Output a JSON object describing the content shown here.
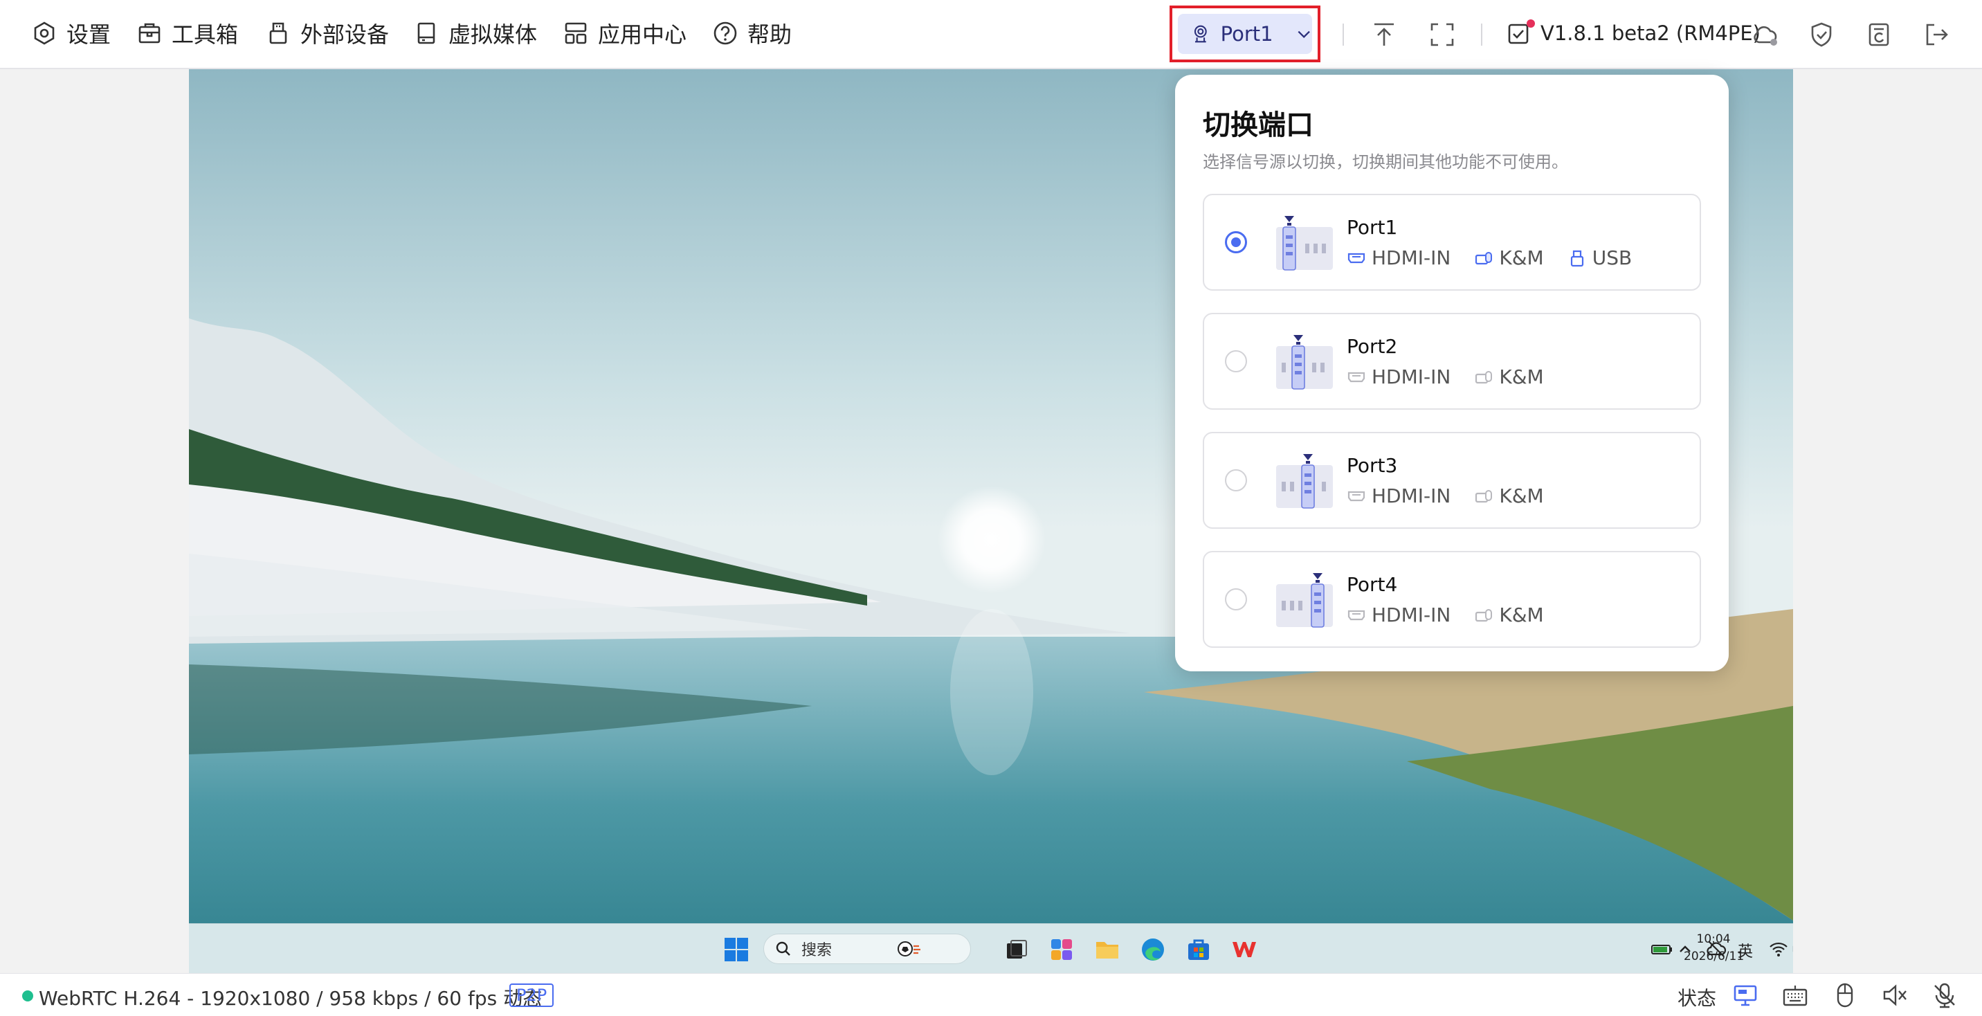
{
  "menu": {
    "settings": "设置",
    "toolbox": "工具箱",
    "peripherals": "外部设备",
    "virtual_media": "虚拟媒体",
    "app_center": "应用中心",
    "help": "帮助"
  },
  "port_selector": {
    "label": "Port1"
  },
  "version": "V1.8.1 beta2 (RM4PE)",
  "popup": {
    "title": "切换端口",
    "subtitle": "选择信号源以切换，切换期间其他功能不可使用。",
    "ports": [
      {
        "name": "Port1",
        "selected": true,
        "tags": [
          "HDMI-IN",
          "K&M",
          "USB"
        ]
      },
      {
        "name": "Port2",
        "selected": false,
        "tags": [
          "HDMI-IN",
          "K&M"
        ]
      },
      {
        "name": "Port3",
        "selected": false,
        "tags": [
          "HDMI-IN",
          "K&M"
        ]
      },
      {
        "name": "Port4",
        "selected": false,
        "tags": [
          "HDMI-IN",
          "K&M"
        ]
      }
    ]
  },
  "taskbar": {
    "search_placeholder": "搜索",
    "ime": "英",
    "time": "10:04",
    "date": "2026/6/11"
  },
  "statusbar": {
    "stream_info": "WebRTC H.264 - 1920x1080 / 958 kbps / 60 fps 动态",
    "badge": "P2P",
    "status_label": "状态"
  },
  "colors": {
    "accent": "#4a6cf0",
    "highlight_border": "#e21f2a",
    "status_dot": "#1fbf8f"
  }
}
